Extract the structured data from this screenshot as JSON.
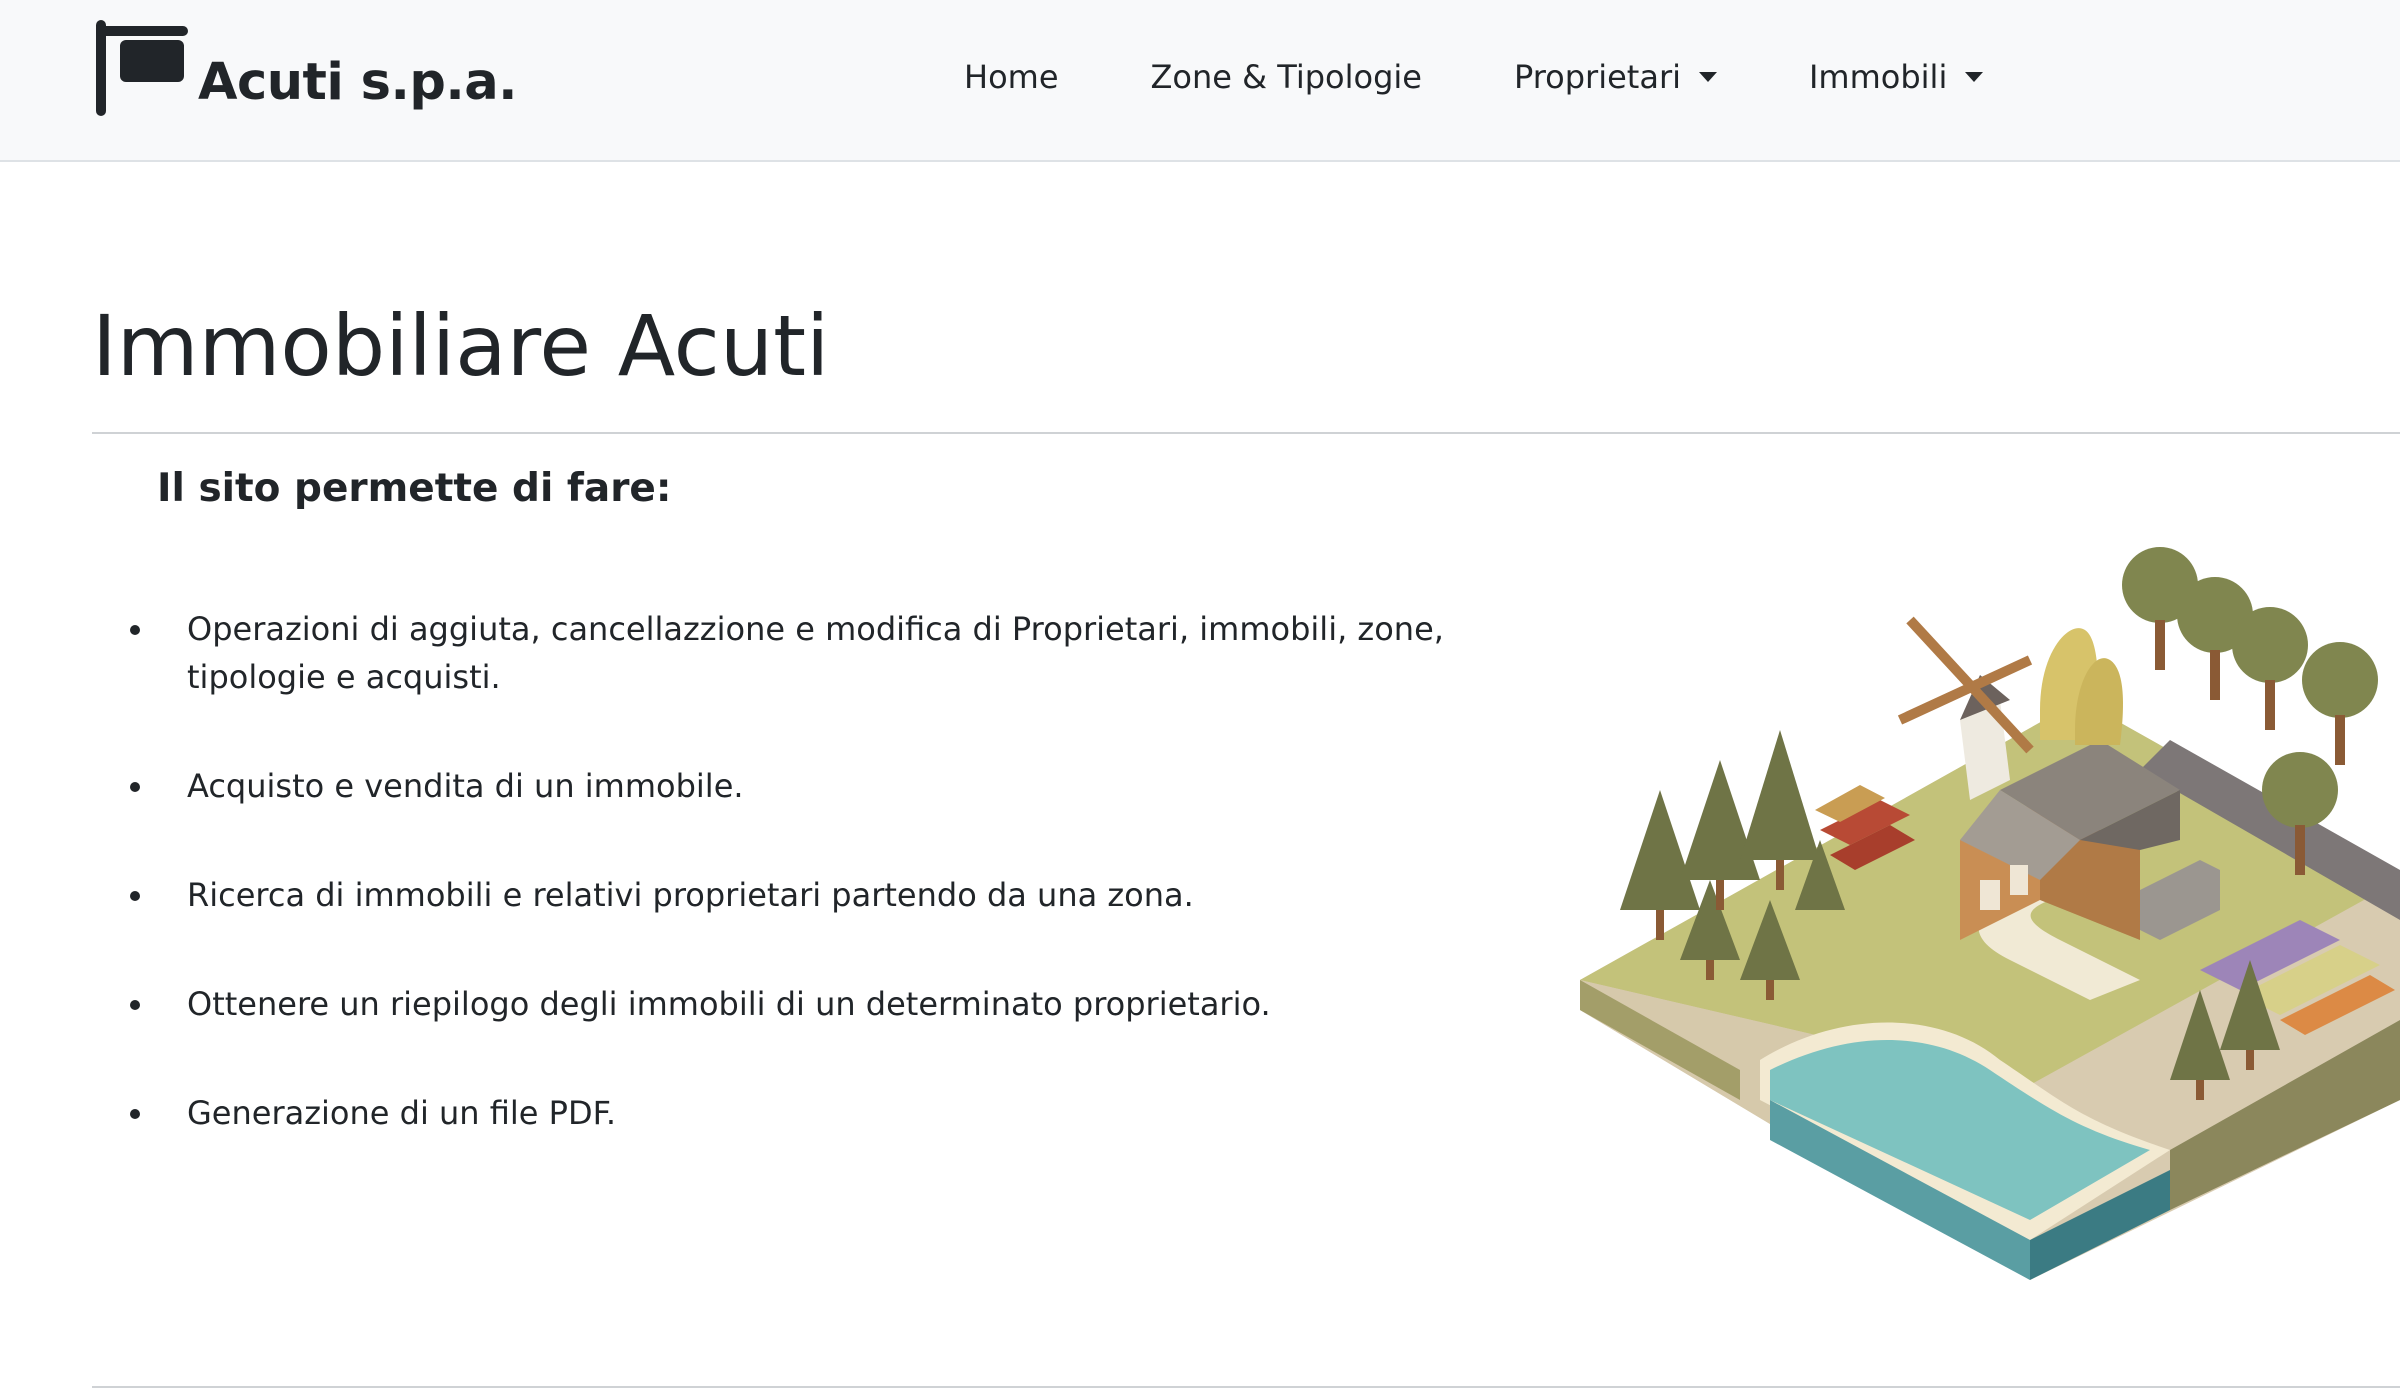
{
  "navbar": {
    "brand": {
      "logo_icon": "signboard-icon",
      "name": "Acuti s.p.a."
    },
    "links": [
      {
        "label": "Home",
        "dropdown": false
      },
      {
        "label": "Zone & Tipologie",
        "dropdown": false
      },
      {
        "label": "Proprietari",
        "dropdown": true
      },
      {
        "label": "Immobili",
        "dropdown": true
      }
    ]
  },
  "main": {
    "title": "Immobiliare Acuti",
    "subtitle": "Il sito permette di fare:",
    "features": [
      "Operazioni di aggiuta, cancellazzione e modifica di Proprietari, immobili, zone, tipologie e acquisti.",
      "Acquisto e vendita di un immobile.",
      "Ricerca di immobili e relativi proprietari partendo da una zona.",
      "Ottenere un riepilogo degli immobili di un determinato proprietario.",
      "Generazione di un file PDF."
    ],
    "illustration": "isometric-farm-illustration"
  },
  "colors": {
    "navbar_bg": "#f8f9fa",
    "text": "#212529",
    "grass": "#c5c17a",
    "water": "#6fb8b8",
    "tree": "#7d7f4f"
  }
}
